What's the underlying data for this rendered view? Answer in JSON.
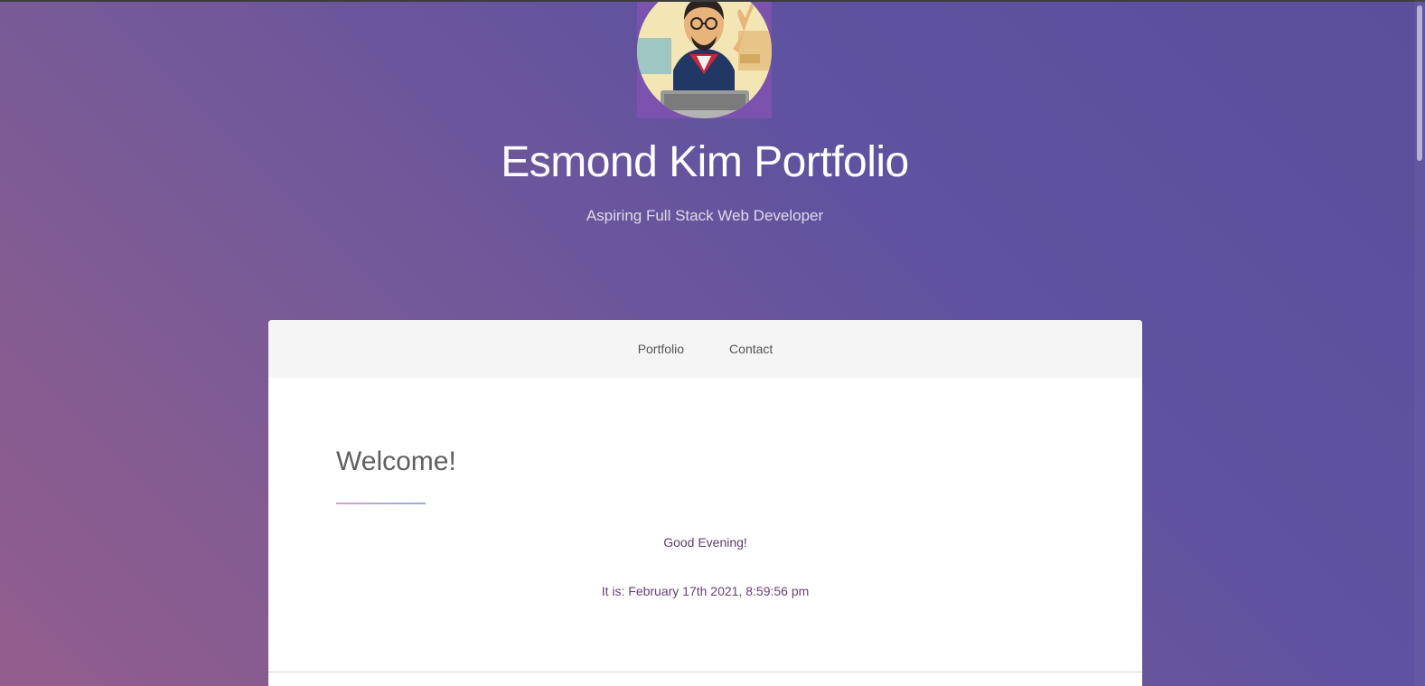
{
  "header": {
    "title": "Esmond Kim Portfolio",
    "subtitle": "Aspiring Full Stack Web Developer"
  },
  "nav": {
    "items": [
      "Portfolio",
      "Contact"
    ]
  },
  "main": {
    "heading": "Welcome!",
    "greeting": "Good Evening!",
    "datetime": "It is: February 17th 2021, 8:59:56 pm"
  },
  "colors": {
    "gradient_start": "#935d8c",
    "gradient_end": "#5b4f9c",
    "accent_text": "#5d3b74"
  }
}
